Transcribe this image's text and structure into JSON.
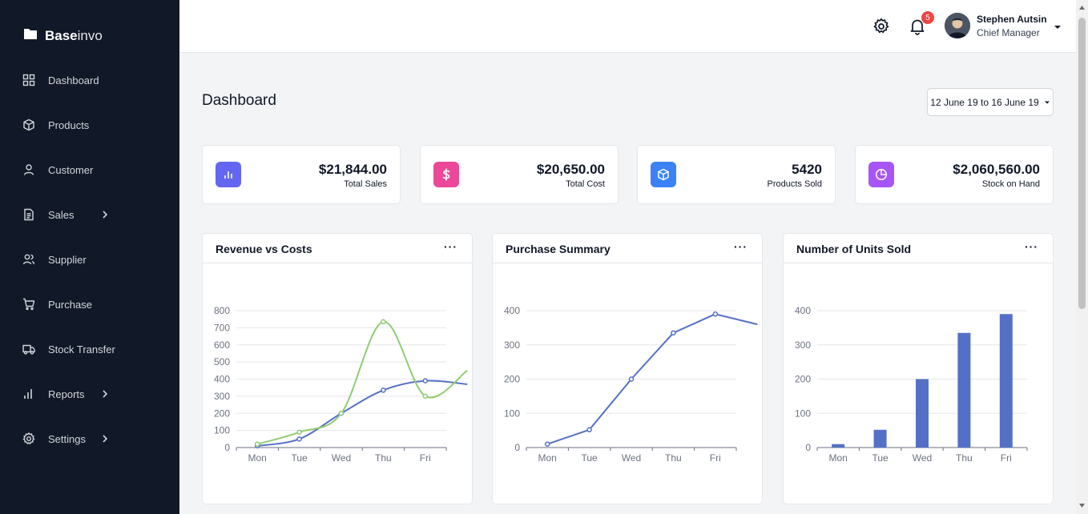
{
  "brand": {
    "bold": "Base",
    "light": "invo"
  },
  "sidebar": {
    "items": [
      {
        "label": "Dashboard",
        "icon": "grid-icon",
        "chevron": false
      },
      {
        "label": "Products",
        "icon": "box-icon",
        "chevron": false
      },
      {
        "label": "Customer",
        "icon": "user-icon",
        "chevron": false
      },
      {
        "label": "Sales",
        "icon": "document-icon",
        "chevron": true
      },
      {
        "label": "Supplier",
        "icon": "users-icon",
        "chevron": false
      },
      {
        "label": "Purchase",
        "icon": "cart-icon",
        "chevron": false
      },
      {
        "label": "Stock Transfer",
        "icon": "truck-icon",
        "chevron": false
      },
      {
        "label": "Reports",
        "icon": "bar-chart-icon",
        "chevron": true
      },
      {
        "label": "Settings",
        "icon": "gear-icon",
        "chevron": true
      }
    ]
  },
  "header": {
    "notification_count": "5",
    "user_name": "Stephen Autsin",
    "user_role": "Chief Manager"
  },
  "main": {
    "title": "Dashboard",
    "date_range": "12 June 19 to 16 June 19"
  },
  "stats": [
    {
      "value": "$21,844.00",
      "label": "Total Sales",
      "color": "#6366f1",
      "icon": "bar-chart-icon"
    },
    {
      "value": "$20,650.00",
      "label": "Total Cost",
      "color": "#ec4899",
      "icon": "dollar-icon"
    },
    {
      "value": "5420",
      "label": "Products Sold",
      "color": "#3b82f6",
      "icon": "cube-icon"
    },
    {
      "value": "$2,060,560.00",
      "label": "Stock on Hand",
      "color": "#a855f7",
      "icon": "pie-chart-icon"
    }
  ],
  "cards": [
    {
      "title": "Revenue vs Costs",
      "menu": "···"
    },
    {
      "title": "Purchase Summary",
      "menu": "···"
    },
    {
      "title": "Number of Units Sold",
      "menu": "···"
    }
  ],
  "colors": {
    "primary": "#5470c6",
    "secondary": "#91cc75"
  },
  "chart_data": [
    {
      "type": "line",
      "title": "Revenue vs Costs",
      "categories": [
        "Mon",
        "Tue",
        "Wed",
        "Thu",
        "Fri"
      ],
      "ylim": [
        0,
        800
      ],
      "yticks": [
        0,
        100,
        200,
        300,
        400,
        500,
        600,
        700,
        800
      ],
      "smooth": true,
      "series": [
        {
          "values": [
            10,
            50,
            200,
            335,
            390
          ],
          "tail": 370,
          "color": "#5470c6"
        },
        {
          "values": [
            20,
            90,
            200,
            735,
            300
          ],
          "tail": 450,
          "color": "#91cc75"
        }
      ]
    },
    {
      "type": "line",
      "title": "Purchase Summary",
      "categories": [
        "Mon",
        "Tue",
        "Wed",
        "Thu",
        "Fri"
      ],
      "ylim": [
        0,
        400
      ],
      "yticks": [
        0,
        100,
        200,
        300,
        400
      ],
      "smooth": false,
      "series": [
        {
          "values": [
            10,
            52,
            200,
            335,
            390
          ],
          "tail": 360,
          "color": "#5470c6"
        }
      ]
    },
    {
      "type": "bar",
      "title": "Number of Units Sold",
      "categories": [
        "Mon",
        "Tue",
        "Wed",
        "Thu",
        "Fri"
      ],
      "ylim": [
        0,
        400
      ],
      "yticks": [
        0,
        100,
        200,
        300,
        400
      ],
      "series": [
        {
          "values": [
            10,
            52,
            200,
            335,
            390
          ],
          "color": "#5470c6"
        }
      ]
    }
  ]
}
